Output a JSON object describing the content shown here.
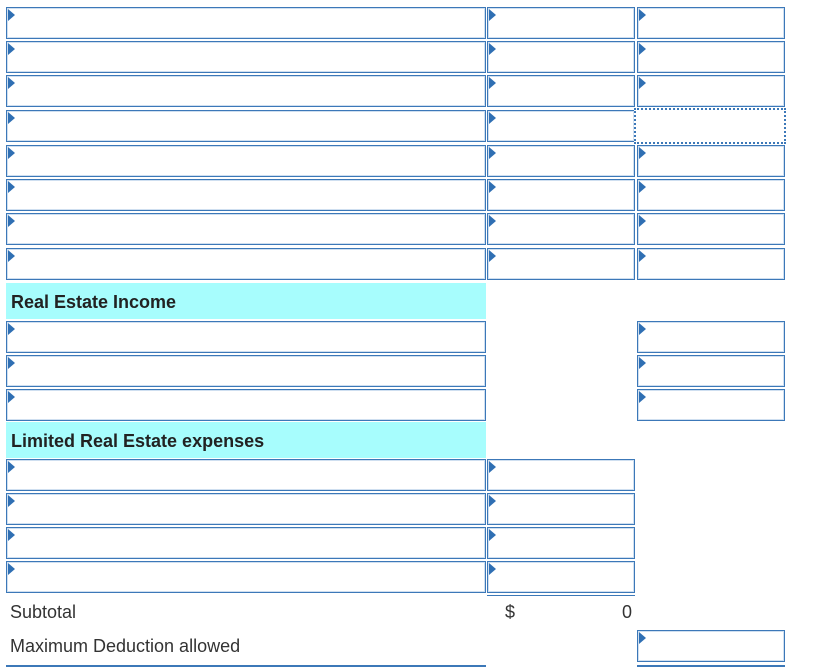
{
  "income_section": {
    "title": "Real Estate Income"
  },
  "expense_section": {
    "title": "Limited Real Estate expenses"
  },
  "subtotal": {
    "label": "Subtotal",
    "currency": "$",
    "value": "0"
  },
  "max_deduction": {
    "label": "Maximum Deduction allowed"
  },
  "colors": {
    "border": "#3c78b8",
    "header_bg": "#a7fdfd",
    "dropdown_arrow": "#2f6fb3"
  }
}
